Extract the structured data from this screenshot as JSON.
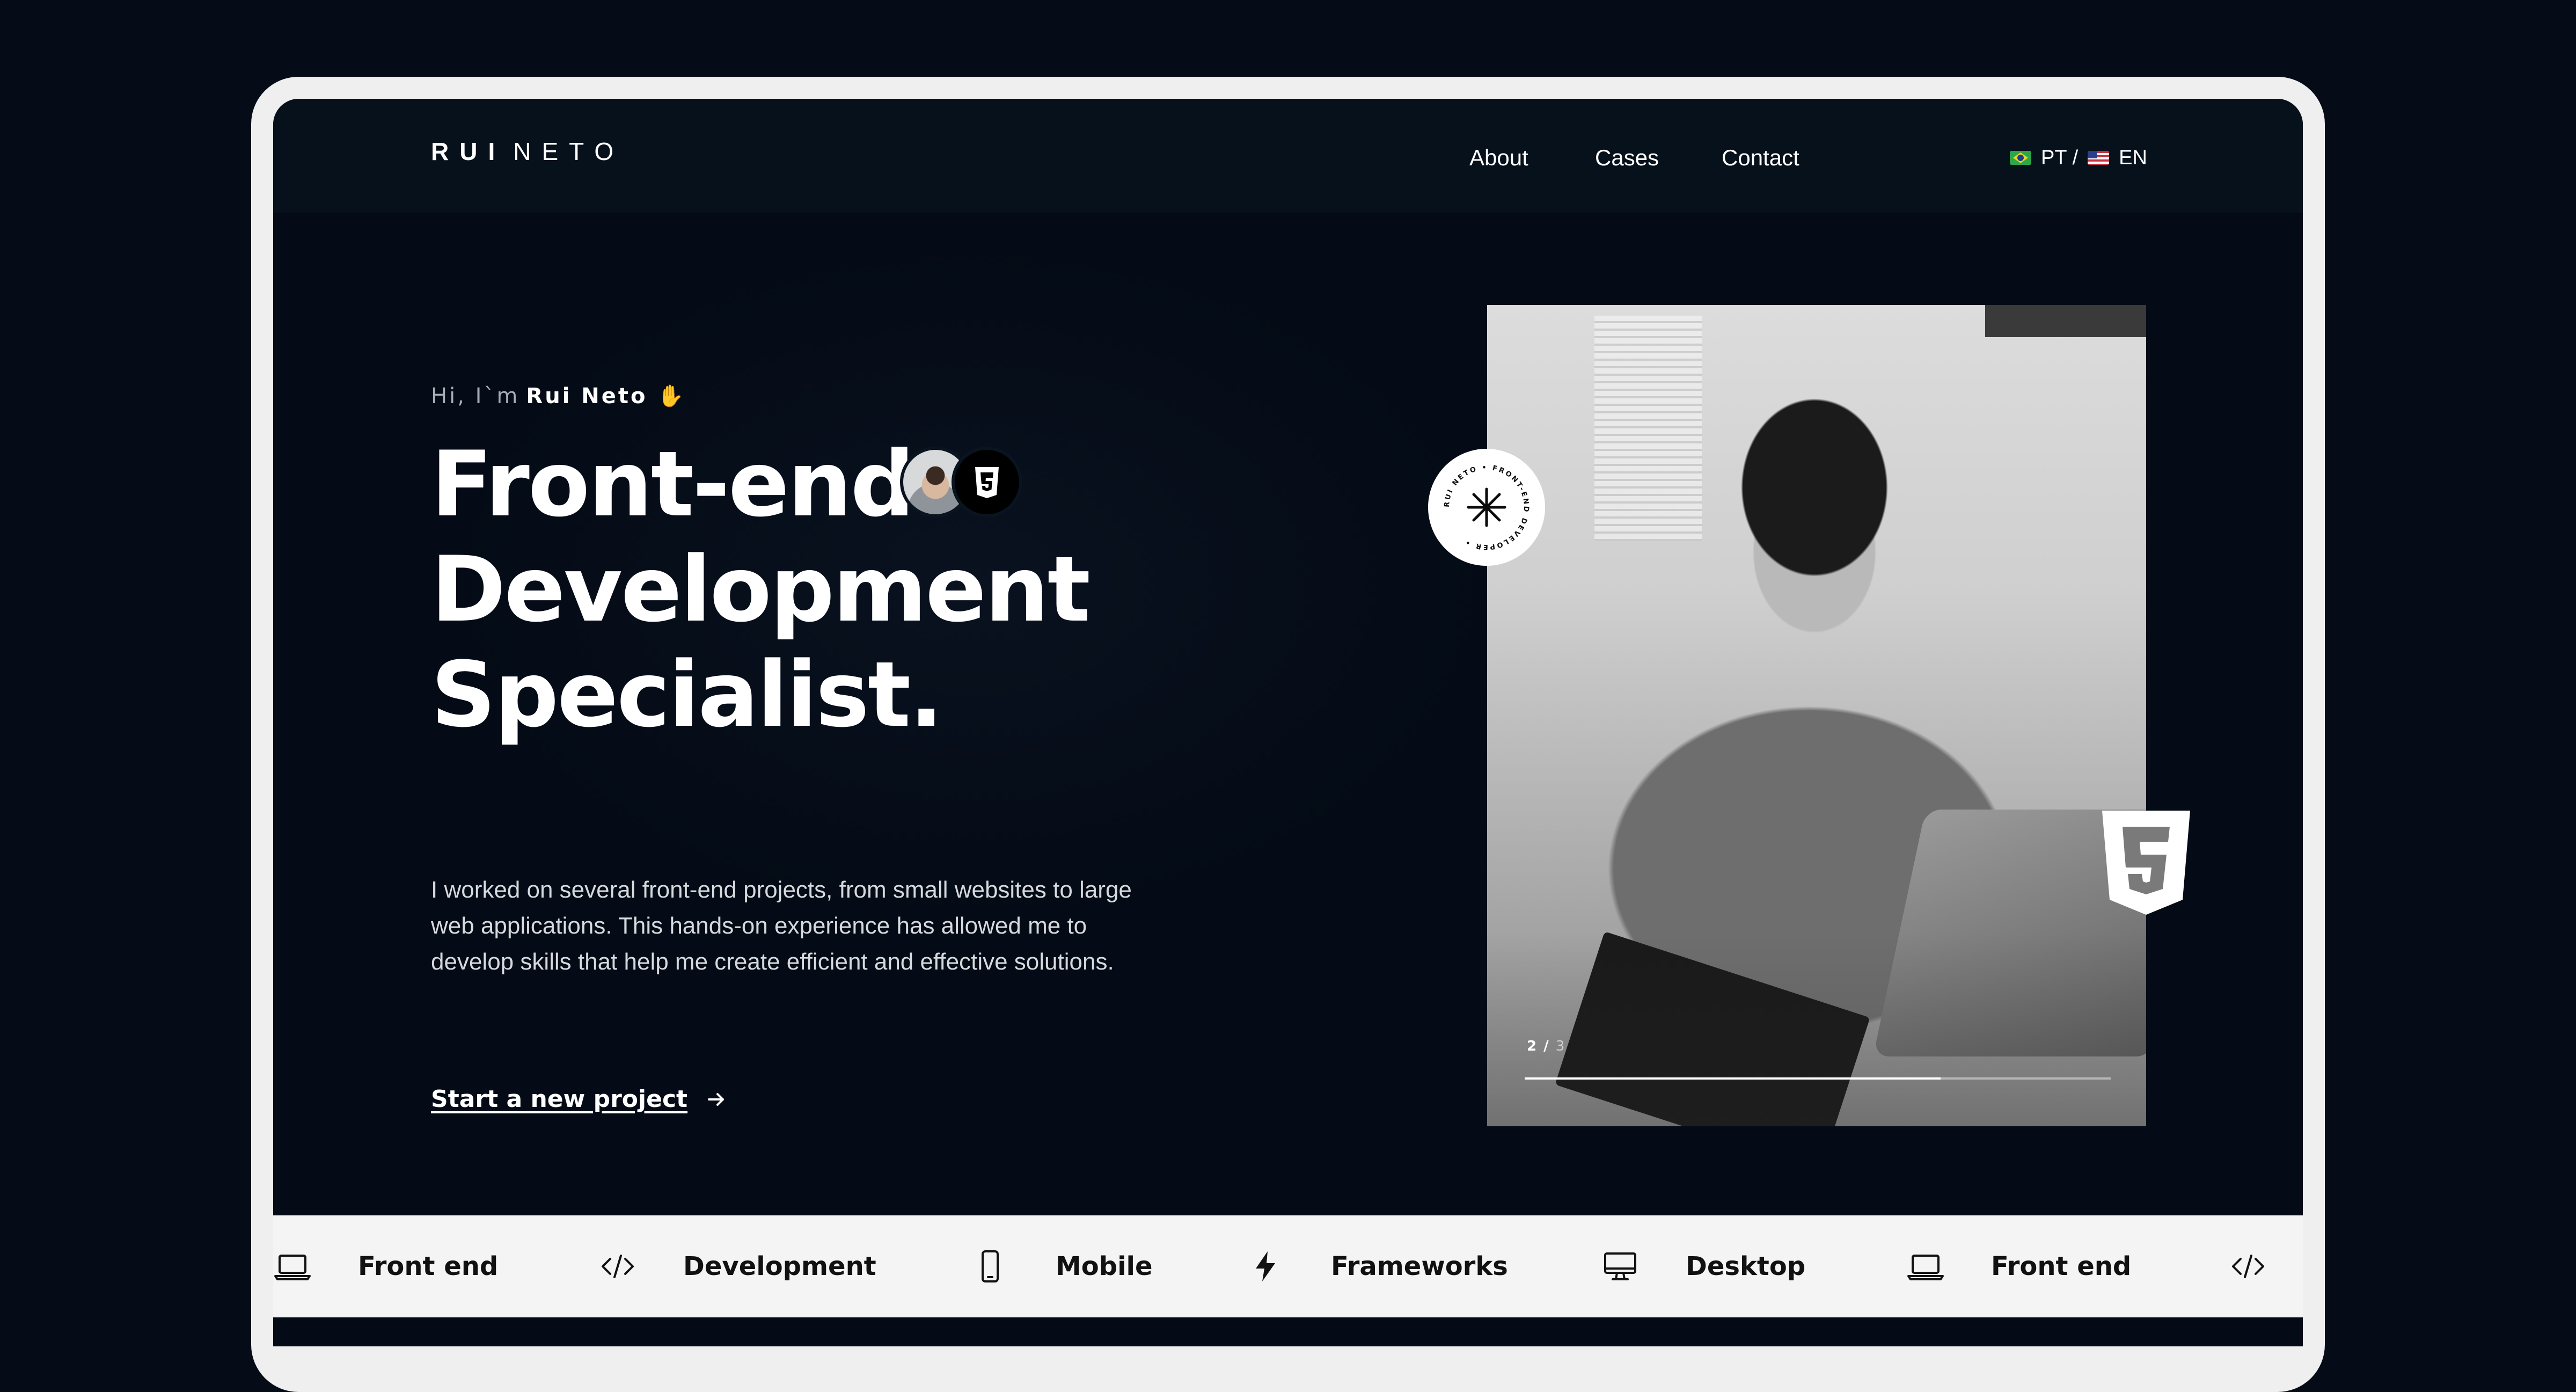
{
  "header": {
    "logo_first": "RUI",
    "logo_last": "NETO",
    "nav": [
      {
        "label": "About"
      },
      {
        "label": "Cases"
      },
      {
        "label": "Contact"
      }
    ],
    "lang": {
      "pt": "PT",
      "separator": "/",
      "en": "EN"
    }
  },
  "hero": {
    "greeting_prefix": "Hi, I`m",
    "greeting_name": "Rui Neto",
    "headline_lines": [
      "Front-end",
      "Development",
      "Specialist."
    ],
    "description": "I worked on several front-end projects, from small websites to large web applications. This hands-on experience has allowed me to develop skills that help me create efficient and effective solutions.",
    "cta_label": "Start a new project"
  },
  "slider": {
    "current": "2",
    "separator": "/",
    "total": "3",
    "progress": 0.71
  },
  "badge": {
    "ring_text": "RUI NETO • FRONT-END DEVELOPER •"
  },
  "ticker": [
    {
      "label": "Front end",
      "icon": "laptop-icon"
    },
    {
      "label": "Development",
      "icon": "code-icon"
    },
    {
      "label": "Mobile",
      "icon": "mobile-icon"
    },
    {
      "label": "Frameworks",
      "icon": "lightning-icon"
    },
    {
      "label": "Desktop",
      "icon": "desktop-icon"
    },
    {
      "label": "Front end",
      "icon": "laptop-icon"
    },
    {
      "label": "",
      "icon": "code-icon"
    }
  ],
  "colors": {
    "background": "#050c17",
    "screen": "#040b16",
    "header": "#07111c",
    "text": "#ffffff",
    "ticker_bg": "#f4f4f4"
  }
}
